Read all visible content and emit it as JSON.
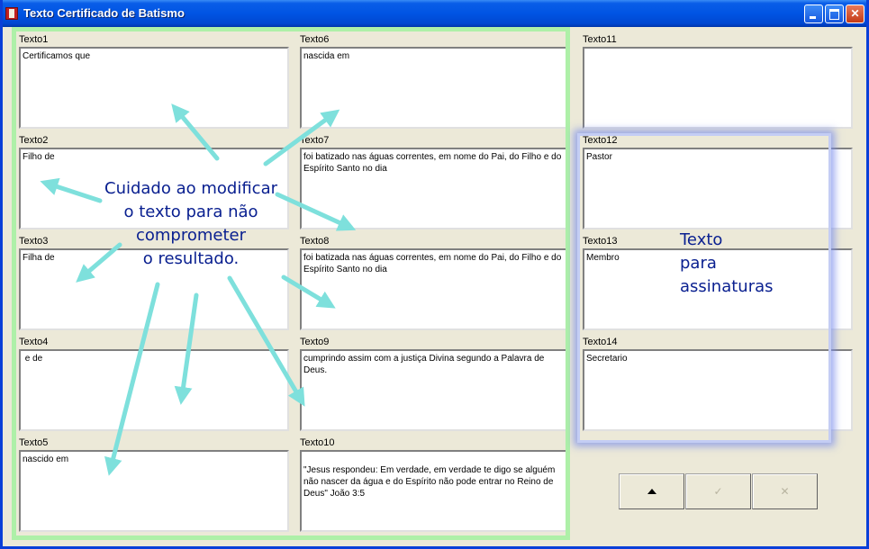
{
  "window": {
    "title": "Texto Certificado de Batismo"
  },
  "fields": [
    {
      "label": "Texto1",
      "value": "Certificamos que"
    },
    {
      "label": "Texto2",
      "value": "Filho de"
    },
    {
      "label": "Texto3",
      "value": "Filha de"
    },
    {
      "label": "Texto4",
      "value": " e de"
    },
    {
      "label": "Texto5",
      "value": "nascido em"
    },
    {
      "label": "Texto6",
      "value": "nascida em"
    },
    {
      "label": "Texto7",
      "value": "foi batizado nas águas correntes, em nome do Pai, do Filho e do Espírito Santo no dia"
    },
    {
      "label": "Texto8",
      "value": "foi batizada nas águas correntes, em nome do Pai, do Filho e do Espírito Santo no dia"
    },
    {
      "label": "Texto9",
      "value": "cumprindo assim com a justiça Divina segundo a Palavra de Deus."
    },
    {
      "label": "Texto10",
      "value": "\"Jesus respondeu: Em verdade, em verdade te digo se alguém não nascer da água e do Espírito não pode entrar no Reino de Deus\" João 3:5"
    },
    {
      "label": "Texto11",
      "value": ""
    },
    {
      "label": "Texto12",
      "value": "Pastor"
    },
    {
      "label": "Texto13",
      "value": "Membro"
    },
    {
      "label": "Texto14",
      "value": "Secretario"
    }
  ],
  "annotations": {
    "warning": [
      "Cuidado ao modificar",
      "o texto para não",
      "comprometer",
      "o resultado."
    ],
    "signatures": [
      "Texto",
      "para",
      "assinaturas"
    ]
  },
  "buttons": {
    "up_icon": "triangle-up-icon",
    "ok_label": "✓",
    "cancel_label": "✕"
  },
  "colors": {
    "title_bar": "#0054e3",
    "annotation_text": "#0a2090",
    "arrow": "#7ee0dc",
    "green_frame": "#aef0a8",
    "blue_frame": "#c4cdf4"
  }
}
